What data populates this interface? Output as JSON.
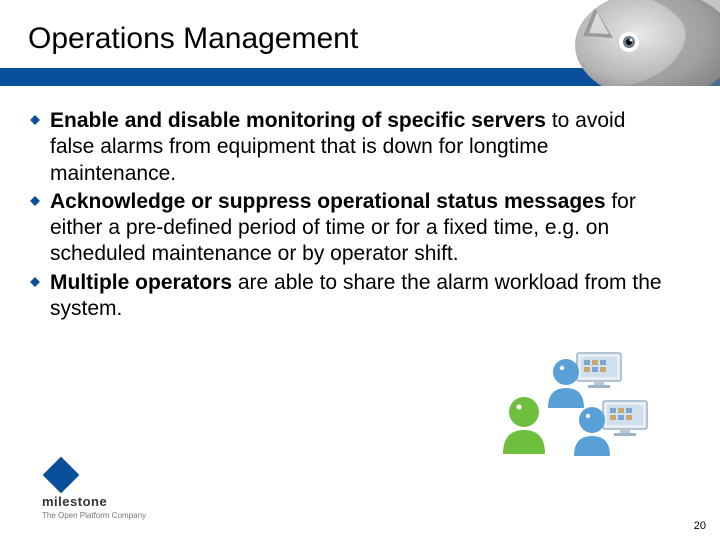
{
  "title": "Operations Management",
  "bullets": [
    {
      "bold": "Enable and disable monitoring of specific servers",
      "rest": " to avoid false alarms from equipment that is down for longtime maintenance."
    },
    {
      "bold": "Acknowledge or suppress operational status messages",
      "rest": " for either a pre-defined period of time or for a fixed time, e.g. on scheduled maintenance or by operator shift."
    },
    {
      "bold": "Multiple operators",
      "rest": " are able to share the alarm workload from the system."
    }
  ],
  "brand": {
    "name": "milestone",
    "tagline": "The Open Platform Company"
  },
  "page_number": "20",
  "colors": {
    "brand_blue": "#0a4f9c",
    "person_blue": "#5aa0d8",
    "person_green": "#6fbf3f"
  }
}
